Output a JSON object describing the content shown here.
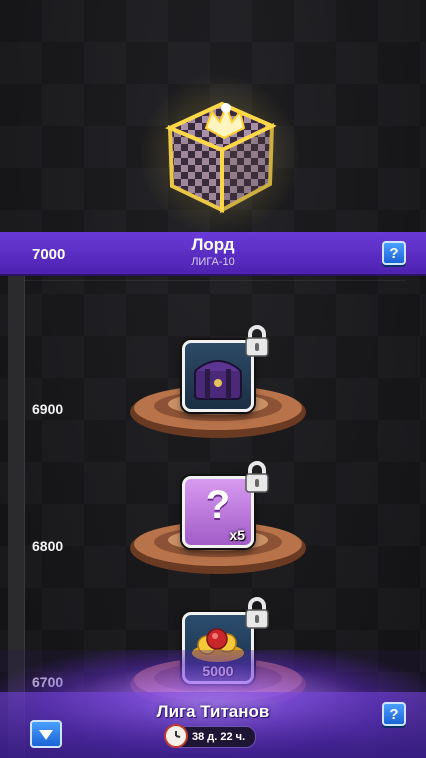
{
  "league": {
    "score": "7000",
    "name": "Лорд",
    "tier": "ЛИГА-10",
    "help_label": "?"
  },
  "milestones": [
    {
      "score": "6900",
      "reward_label": "",
      "reward_icon": "purple-chest-icon",
      "locked": true
    },
    {
      "score": "6800",
      "reward_label": "x5",
      "reward_icon": "mystery-box-icon",
      "locked": true
    },
    {
      "score": "6700",
      "reward_label": "5000",
      "reward_icon": "gold-coins-icon",
      "locked": true
    }
  ],
  "next_league": {
    "name": "Лига Титанов",
    "timer": "38 д. 22 ч.",
    "help_label": "?"
  },
  "colors": {
    "league_bar": "#5a2dc6",
    "button_blue": "#2b7de9",
    "mystery_box": "#c77ee6"
  }
}
